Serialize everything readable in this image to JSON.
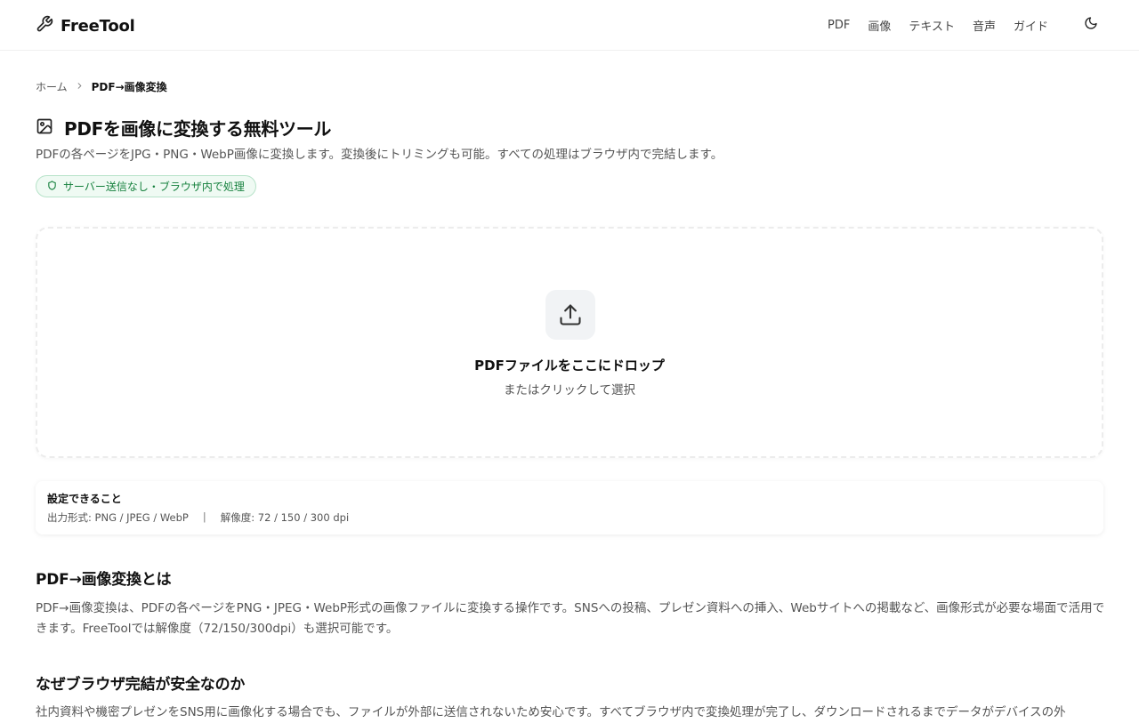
{
  "header": {
    "brand": "FreeTool",
    "nav": [
      "PDF",
      "画像",
      "テキスト",
      "音声",
      "ガイド"
    ]
  },
  "breadcrumb": {
    "home": "ホーム",
    "current": "PDF→画像変換"
  },
  "page": {
    "title": "PDFを画像に変換する無料ツール",
    "subtitle": "PDFの各ページをJPG・PNG・WebP画像に変換します。変換後にトリミングも可能。すべての処理はブラウザ内で完結します。",
    "badge": "サーバー送信なし・ブラウザ内で処理"
  },
  "dropzone": {
    "title": "PDFファイルをここにドロップ",
    "subtitle": "またはクリックして選択"
  },
  "settings": {
    "heading": "設定できること",
    "formats": "出力形式: PNG / JPEG / WebP",
    "separator": "|",
    "resolution": "解像度: 72 / 150 / 300 dpi"
  },
  "sections": [
    {
      "heading": "PDF→画像変換とは",
      "body": "PDF→画像変換は、PDFの各ページをPNG・JPEG・WebP形式の画像ファイルに変換する操作です。SNSへの投稿、プレゼン資料への挿入、Webサイトへの掲載など、画像形式が必要な場面で活用できます。FreeToolでは解像度（72/150/300dpi）も選択可能です。"
    },
    {
      "heading": "なぜブラウザ完結が安全なのか",
      "body": "社内資料や機密プレゼンをSNS用に画像化する場合でも、ファイルが外部に送信されないため安心です。すべてブラウザ内で変換処理が完了し、ダウンロードされるまでデータがデバイスの外"
    }
  ],
  "colors": {
    "accent_green": "#15803d",
    "badge_bg": "#effaf3",
    "text_primary": "#111111",
    "text_muted": "#555555"
  },
  "icons": {
    "brand": "wrench-icon",
    "theme": "moon-icon",
    "title": "image-icon",
    "badge": "shield-icon",
    "upload": "upload-icon",
    "breadcrumb_sep": "chevron-right-icon"
  }
}
